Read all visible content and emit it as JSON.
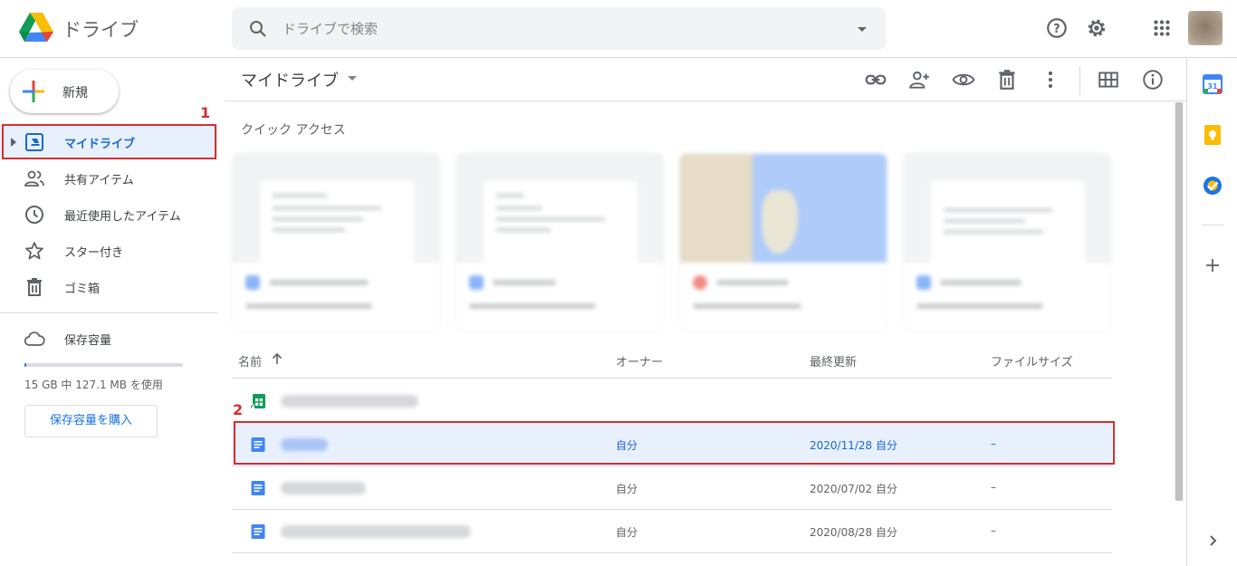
{
  "header": {
    "app_title": "ドライブ",
    "search_placeholder": "ドライブで検索"
  },
  "sidebar": {
    "new_label": "新規",
    "items": [
      {
        "label": "マイドライブ",
        "icon": "my-drive-icon",
        "active": true
      },
      {
        "label": "共有アイテム",
        "icon": "shared-icon"
      },
      {
        "label": "最近使用したアイテム",
        "icon": "recent-icon"
      },
      {
        "label": "スター付き",
        "icon": "star-icon"
      },
      {
        "label": "ゴミ箱",
        "icon": "trash-icon"
      }
    ],
    "storage_label": "保存容量",
    "storage_usage": "15 GB 中 127.1 MB を使用",
    "storage_fraction": 0.01,
    "buy_storage_label": "保存容量を購入"
  },
  "main": {
    "breadcrumb": "マイドライブ",
    "quick_access_title": "クイック アクセス",
    "columns": {
      "name": "名前",
      "owner": "オーナー",
      "modified": "最終更新",
      "size": "ファイルサイズ"
    },
    "rows": [
      {
        "type": "shortcut",
        "owner": "",
        "modified": "",
        "size": ""
      },
      {
        "type": "doc",
        "owner": "自分",
        "modified": "2020/11/28 自分",
        "size": "–",
        "selected": true
      },
      {
        "type": "doc",
        "owner": "自分",
        "modified": "2020/07/02 自分",
        "size": "–"
      },
      {
        "type": "doc",
        "owner": "自分",
        "modified": "2020/08/28 自分",
        "size": "–"
      }
    ]
  },
  "annotations": [
    "1",
    "2"
  ],
  "colors": {
    "accent": "#1a73e8",
    "selection": "#e8f0fe",
    "annotation": "#d32f2f"
  }
}
